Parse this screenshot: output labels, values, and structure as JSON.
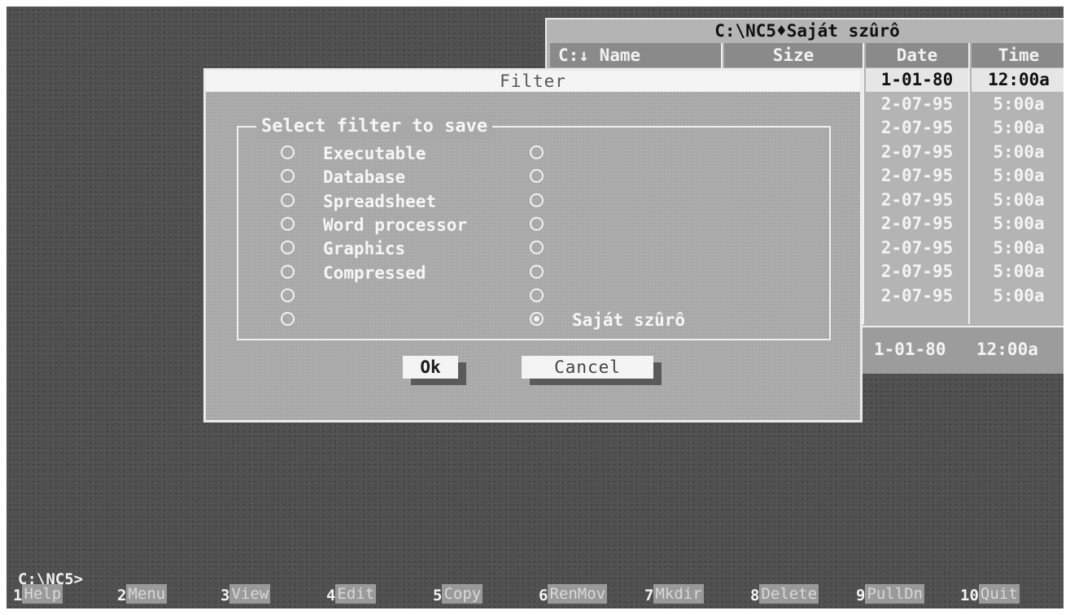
{
  "panel": {
    "title": "C:\\NC5♦Saját szûrô",
    "columns": {
      "name": "C:↓ Name",
      "size": "Size",
      "date": "Date",
      "time": "Time"
    },
    "rows": [
      {
        "date": "1-01-80",
        "time": "12:00a",
        "selected": true
      },
      {
        "date": "2-07-95",
        "time": "5:00a"
      },
      {
        "date": "2-07-95",
        "time": "5:00a"
      },
      {
        "date": "2-07-95",
        "time": "5:00a"
      },
      {
        "date": "2-07-95",
        "time": "5:00a"
      },
      {
        "date": "2-07-95",
        "time": "5:00a"
      },
      {
        "date": "2-07-95",
        "time": "5:00a"
      },
      {
        "date": "2-07-95",
        "time": "5:00a"
      },
      {
        "date": "2-07-95",
        "time": "5:00a"
      },
      {
        "date": "2-07-95",
        "time": "5:00a"
      }
    ],
    "footer": {
      "date": "1-01-80",
      "time": "12:00a"
    }
  },
  "dialog": {
    "title": "Filter",
    "group_label": "Select filter to save",
    "left_options": [
      {
        "label": "Executable",
        "selected": false
      },
      {
        "label": "Database",
        "selected": false
      },
      {
        "label": "Spreadsheet",
        "selected": false
      },
      {
        "label": "Word processor",
        "selected": false
      },
      {
        "label": "Graphics",
        "selected": false
      },
      {
        "label": "Compressed",
        "selected": false
      },
      {
        "label": "",
        "selected": false
      },
      {
        "label": "",
        "selected": false
      }
    ],
    "right_options": [
      {
        "label": "",
        "selected": false
      },
      {
        "label": "",
        "selected": false
      },
      {
        "label": "",
        "selected": false
      },
      {
        "label": "",
        "selected": false
      },
      {
        "label": "",
        "selected": false
      },
      {
        "label": "",
        "selected": false
      },
      {
        "label": "",
        "selected": false
      },
      {
        "label": "Saját szûrô",
        "selected": true
      }
    ],
    "ok_label": "Ok",
    "cancel_label": "Cancel"
  },
  "prompt": "C:\\NC5>",
  "fkeys": [
    {
      "num": "1",
      "label": "Help"
    },
    {
      "num": "2",
      "label": "Menu"
    },
    {
      "num": "3",
      "label": "View"
    },
    {
      "num": "4",
      "label": "Edit"
    },
    {
      "num": "5",
      "label": "Copy"
    },
    {
      "num": "6",
      "label": "RenMov"
    },
    {
      "num": "7",
      "label": "Mkdir"
    },
    {
      "num": "8",
      "label": "Delete"
    },
    {
      "num": "9",
      "label": "PullDn"
    },
    {
      "num": "10",
      "label": "Quit"
    }
  ]
}
